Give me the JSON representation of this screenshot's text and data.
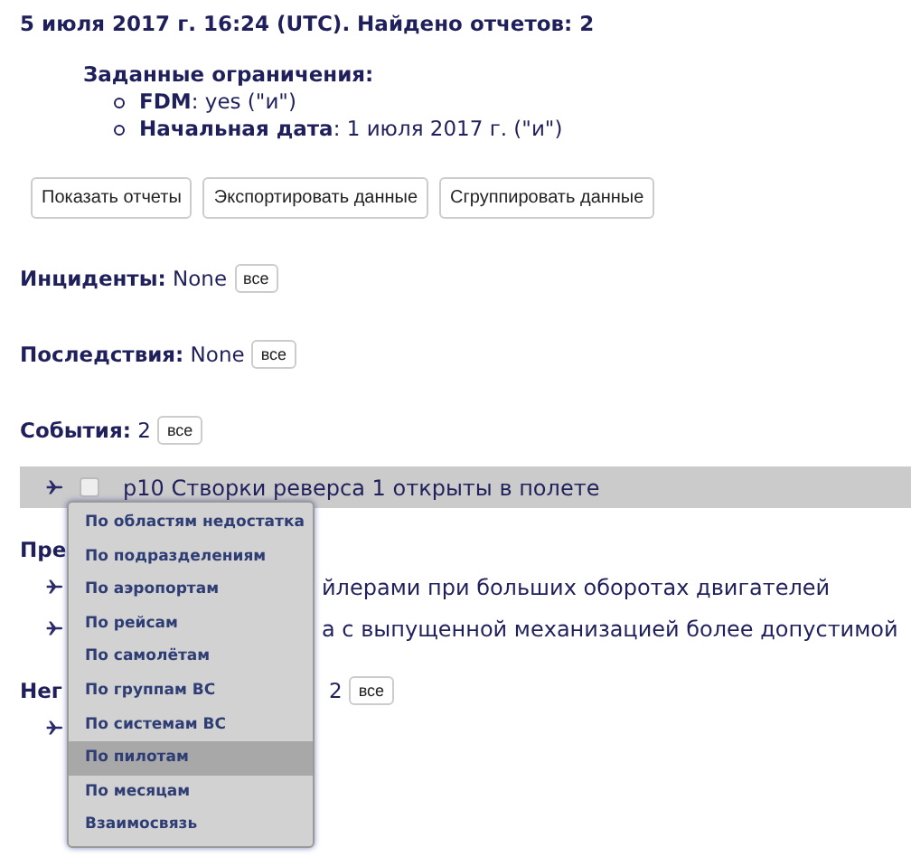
{
  "title": "5 июля 2017 г. 16:24 (UTC). Найдено отчетов: 2",
  "constraints": {
    "heading": "Заданные ограничения:",
    "items": [
      {
        "label": "FDM",
        "value": ": yes (\"и\")"
      },
      {
        "label": "Начальная дата",
        "value": ": 1 июля 2017 г. (\"и\")"
      }
    ]
  },
  "buttons": [
    "Показать отчеты",
    "Экспортировать данные",
    "Сгруппировать данные"
  ],
  "sections": [
    {
      "label": "Инциденты:",
      "value": "None",
      "button": "все"
    },
    {
      "label": "Последствия:",
      "value": "None",
      "button": "все"
    },
    {
      "label": "События:",
      "value": "2",
      "button": "все"
    }
  ],
  "event_rows": [
    {
      "text": "p10 Створки реверса 1 открыты в полете",
      "checked": false,
      "highlighted": true
    }
  ],
  "covered": [
    {
      "kind": "heading",
      "prefix": "Пре"
    },
    {
      "kind": "row",
      "suffix": "йлерами при больших оборотах двигателей"
    },
    {
      "kind": "row",
      "suffix": "а с выпущенной механизацией более допустимой"
    },
    {
      "kind": "heading",
      "prefix": "Нег",
      "suffix": "2",
      "button": "все"
    },
    {
      "kind": "row"
    }
  ],
  "group_menu": [
    {
      "label": "По областям недостатка",
      "selected": false
    },
    {
      "label": "По подразделениям",
      "selected": false
    },
    {
      "label": "По аэропортам",
      "selected": false
    },
    {
      "label": "По рейсам",
      "selected": false
    },
    {
      "label": "По самолётам",
      "selected": false
    },
    {
      "label": "По группам ВС",
      "selected": false
    },
    {
      "label": "По системам ВС",
      "selected": false
    },
    {
      "label": "По пилотам",
      "selected": true
    },
    {
      "label": "По месяцам",
      "selected": false
    },
    {
      "label": "Взаимосвязь",
      "selected": false
    }
  ]
}
